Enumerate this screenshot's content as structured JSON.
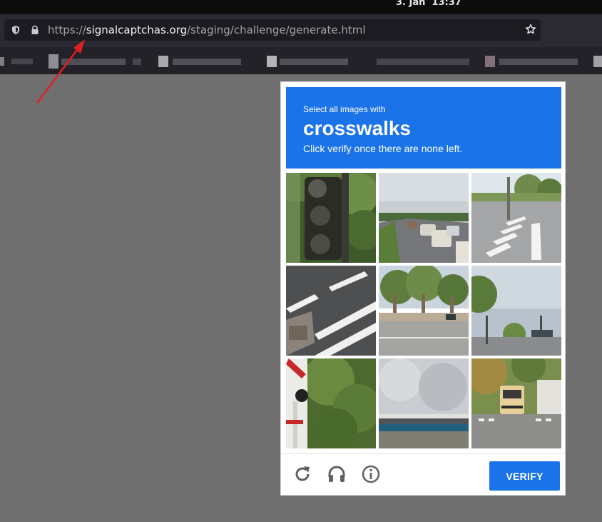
{
  "system_bar": {
    "clock": "3. Jan  13:37"
  },
  "browser": {
    "url": {
      "scheme": "https://",
      "domain": "signalcaptchas.org",
      "path": "/staging/challenge/generate.html"
    },
    "icons": [
      "shield-icon",
      "lock-icon",
      "bookmark-star-icon"
    ]
  },
  "captcha": {
    "prompt_small": "Select all images with",
    "prompt_target": "crosswalks",
    "prompt_hint": "Click verify once there are none left.",
    "tiles": [
      "traffic-signal",
      "highway-traffic",
      "crosswalk-corner",
      "crosswalk-stripes",
      "palm-trees-road",
      "intersection",
      "railroad-crossing",
      "building-roof",
      "school-bus-street"
    ],
    "footer_icons": [
      "refresh-icon",
      "headphones-icon",
      "info-icon"
    ],
    "verify_label": "VERIFY",
    "colors": {
      "accent": "#1a73e8"
    }
  }
}
